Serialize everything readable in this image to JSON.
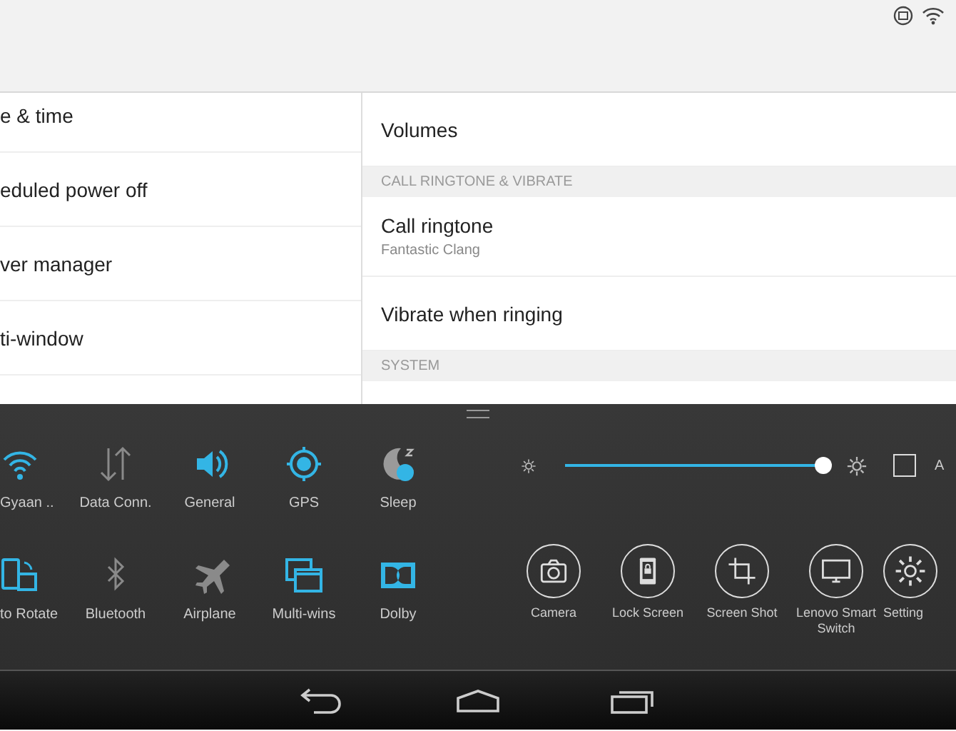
{
  "left_list": [
    {
      "label": "e & time"
    },
    {
      "label": "eduled power off"
    },
    {
      "label": "ver manager"
    },
    {
      "label": "ti-window"
    }
  ],
  "right_list": [
    {
      "kind": "item",
      "label": "Volumes"
    },
    {
      "kind": "header",
      "label": "CALL RINGTONE & VIBRATE"
    },
    {
      "kind": "item",
      "label": "Call ringtone",
      "summary": "Fantastic Clang"
    },
    {
      "kind": "item",
      "label": "Vibrate when ringing"
    },
    {
      "kind": "header",
      "label": "SYSTEM"
    }
  ],
  "quick_tiles": [
    {
      "kind": "wifi",
      "label": "Gyaan ..",
      "on": true
    },
    {
      "kind": "data",
      "label": "Data Conn.",
      "on": false
    },
    {
      "kind": "sound",
      "label": "General",
      "on": true
    },
    {
      "kind": "gps",
      "label": "GPS",
      "on": true
    },
    {
      "kind": "sleep",
      "label": "Sleep",
      "on": true
    },
    {
      "kind": "rotate",
      "label": "to Rotate",
      "on": true
    },
    {
      "kind": "bluetooth",
      "label": "Bluetooth",
      "on": false
    },
    {
      "kind": "airplane",
      "label": "Airplane",
      "on": false
    },
    {
      "kind": "multiwin",
      "label": "Multi-wins",
      "on": true
    },
    {
      "kind": "dolby",
      "label": "Dolby",
      "on": true
    }
  ],
  "brightness": {
    "level": 1.0,
    "auto": {
      "label": "A",
      "checked": false
    }
  },
  "shortcuts": [
    {
      "kind": "camera",
      "label": "Camera"
    },
    {
      "kind": "lock",
      "label": "Lock Screen"
    },
    {
      "kind": "crop",
      "label": "Screen Shot"
    },
    {
      "kind": "monitor",
      "label": "Lenovo Smart Switch"
    },
    {
      "kind": "gear",
      "label": "Setting"
    }
  ]
}
